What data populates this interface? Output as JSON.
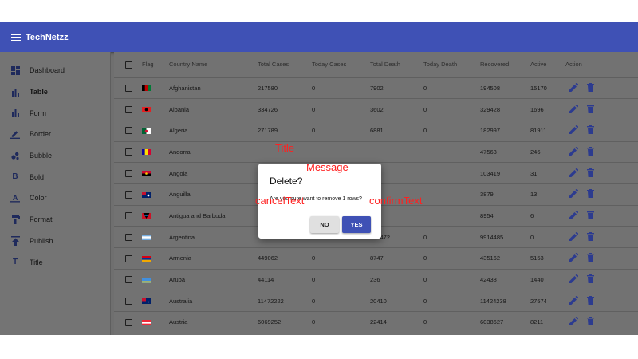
{
  "app": {
    "title": "TechNetzz"
  },
  "colors": {
    "primary": "#3f51b5",
    "annotation": "#ff2020"
  },
  "sidebar": {
    "items": [
      {
        "label": "Dashboard",
        "icon": "dashboard-icon"
      },
      {
        "label": "Table",
        "icon": "bar-chart-icon",
        "active": true
      },
      {
        "label": "Form",
        "icon": "bar-chart-icon"
      },
      {
        "label": "Border",
        "icon": "pencil-underline-icon"
      },
      {
        "label": "Bubble",
        "icon": "bubble-chart-icon"
      },
      {
        "label": "Bold",
        "icon": "bold-icon"
      },
      {
        "label": "Color",
        "icon": "text-color-icon"
      },
      {
        "label": "Format",
        "icon": "format-paint-icon"
      },
      {
        "label": "Publish",
        "icon": "publish-icon"
      },
      {
        "label": "Title",
        "icon": "title-icon"
      }
    ]
  },
  "table": {
    "headers": [
      "Flag",
      "Country Name",
      "Total Cases",
      "Today Cases",
      "Total Death",
      "Today Death",
      "Recovered",
      "Active",
      "Action"
    ],
    "rows": [
      {
        "country": "Afghanistan",
        "total_cases": "217580",
        "today_cases": "0",
        "total_death": "7902",
        "today_death": "0",
        "recovered": "194508",
        "active": "15170"
      },
      {
        "country": "Albania",
        "total_cases": "334726",
        "today_cases": "0",
        "total_death": "3602",
        "today_death": "0",
        "recovered": "329428",
        "active": "1696"
      },
      {
        "country": "Algeria",
        "total_cases": "271789",
        "today_cases": "0",
        "total_death": "6881",
        "today_death": "0",
        "recovered": "182997",
        "active": "81911"
      },
      {
        "country": "Andorra",
        "total_cases": "",
        "today_cases": "",
        "total_death": "",
        "today_death": "",
        "recovered": "47563",
        "active": "246"
      },
      {
        "country": "Angola",
        "total_cases": "",
        "today_cases": "",
        "total_death": "4",
        "today_death": "",
        "recovered": "103419",
        "active": "31"
      },
      {
        "country": "Anguilla",
        "total_cases": "",
        "today_cases": "",
        "total_death": "",
        "today_death": "",
        "recovered": "3879",
        "active": "13"
      },
      {
        "country": "Antigua and Barbuda",
        "total_cases": "",
        "today_cases": "",
        "total_death": "",
        "today_death": "",
        "recovered": "8954",
        "active": "6"
      },
      {
        "country": "Argentina",
        "total_cases": "10044957",
        "today_cases": "0",
        "total_death": "130472",
        "today_death": "0",
        "recovered": "9914485",
        "active": "0"
      },
      {
        "country": "Armenia",
        "total_cases": "449062",
        "today_cases": "0",
        "total_death": "8747",
        "today_death": "0",
        "recovered": "435162",
        "active": "5153"
      },
      {
        "country": "Aruba",
        "total_cases": "44114",
        "today_cases": "0",
        "total_death": "236",
        "today_death": "0",
        "recovered": "42438",
        "active": "1440"
      },
      {
        "country": "Australia",
        "total_cases": "11472222",
        "today_cases": "0",
        "total_death": "20410",
        "today_death": "0",
        "recovered": "11424238",
        "active": "27574"
      },
      {
        "country": "Austria",
        "total_cases": "6069252",
        "today_cases": "0",
        "total_death": "22414",
        "today_death": "0",
        "recovered": "6038627",
        "active": "8211"
      }
    ]
  },
  "dialog": {
    "title": "Delete?",
    "message": "Are you sure want to remove 1 rows?",
    "cancel_text": "NO",
    "confirm_text": "YES"
  },
  "annotations": {
    "title": "Title",
    "message": "Message",
    "cancel": "cancelText",
    "confirm": "confirmText"
  }
}
